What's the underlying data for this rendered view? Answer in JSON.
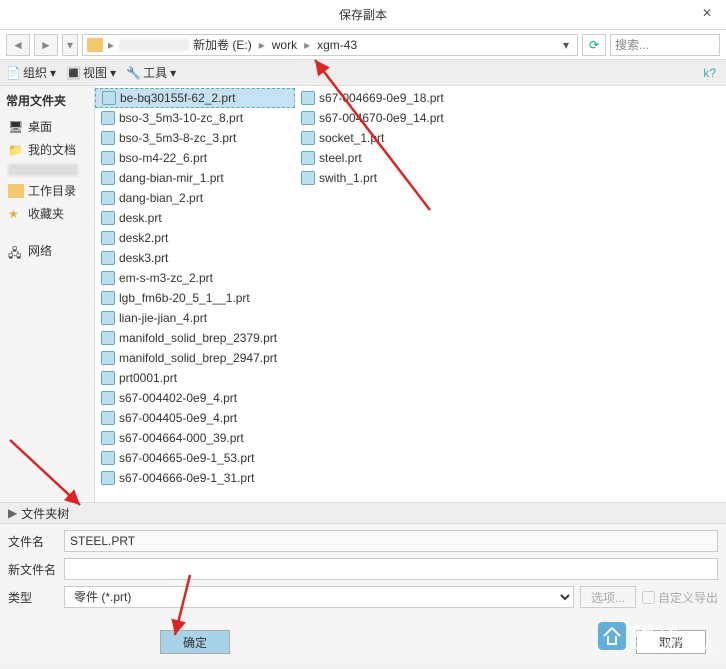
{
  "title": "保存副本",
  "path": {
    "drive": "新加卷 (E:)",
    "segments": [
      "work",
      "xgm-43"
    ]
  },
  "search_placeholder": "搜索...",
  "toolbar": {
    "organize": "组织",
    "views": "视图",
    "tools": "工具"
  },
  "sidebar": {
    "header": "常用文件夹",
    "items": [
      {
        "label": "桌面",
        "icon": "desktop"
      },
      {
        "label": "我的文档",
        "icon": "docs"
      },
      {
        "label": "",
        "icon": "blur"
      },
      {
        "label": "工作目录",
        "icon": "folder"
      },
      {
        "label": "收藏夹",
        "icon": "fav"
      },
      {
        "label": "",
        "icon": ""
      },
      {
        "label": "网络",
        "icon": "network"
      }
    ]
  },
  "files_col1": [
    "be-bq30155f-62_2.prt",
    "bso-3_5m3-10-zc_8.prt",
    "bso-3_5m3-8-zc_3.prt",
    "bso-m4-22_6.prt",
    "dang-bian-mir_1.prt",
    "dang-bian_2.prt",
    "desk.prt",
    "desk2.prt",
    "desk3.prt",
    "em-s-m3-zc_2.prt",
    "lgb_fm6b-20_5_1__1.prt",
    "lian-jie-jian_4.prt",
    "manifold_solid_brep_2379.prt",
    "manifold_solid_brep_2947.prt",
    "prt0001.prt",
    "s67-004402-0e9_4.prt",
    "s67-004405-0e9_4.prt",
    "s67-004664-000_39.prt",
    "s67-004665-0e9-1_53.prt",
    "s67-004666-0e9-1_31.prt"
  ],
  "files_col2": [
    "s67-004669-0e9_18.prt",
    "s67-004670-0e9_14.prt",
    "socket_1.prt",
    "steel.prt",
    "swith_1.prt"
  ],
  "selected_index": 0,
  "tree_toggle": "文件夹树",
  "form": {
    "filename_label": "文件名",
    "filename_value": "STEEL.PRT",
    "newname_label": "新文件名",
    "newname_value": "",
    "type_label": "类型",
    "type_value": "零件 (*.prt)",
    "options_btn": "选项...",
    "custom_export": "自定义导出"
  },
  "buttons": {
    "ok": "确定",
    "cancel": "取消"
  },
  "watermark": "系统之家"
}
